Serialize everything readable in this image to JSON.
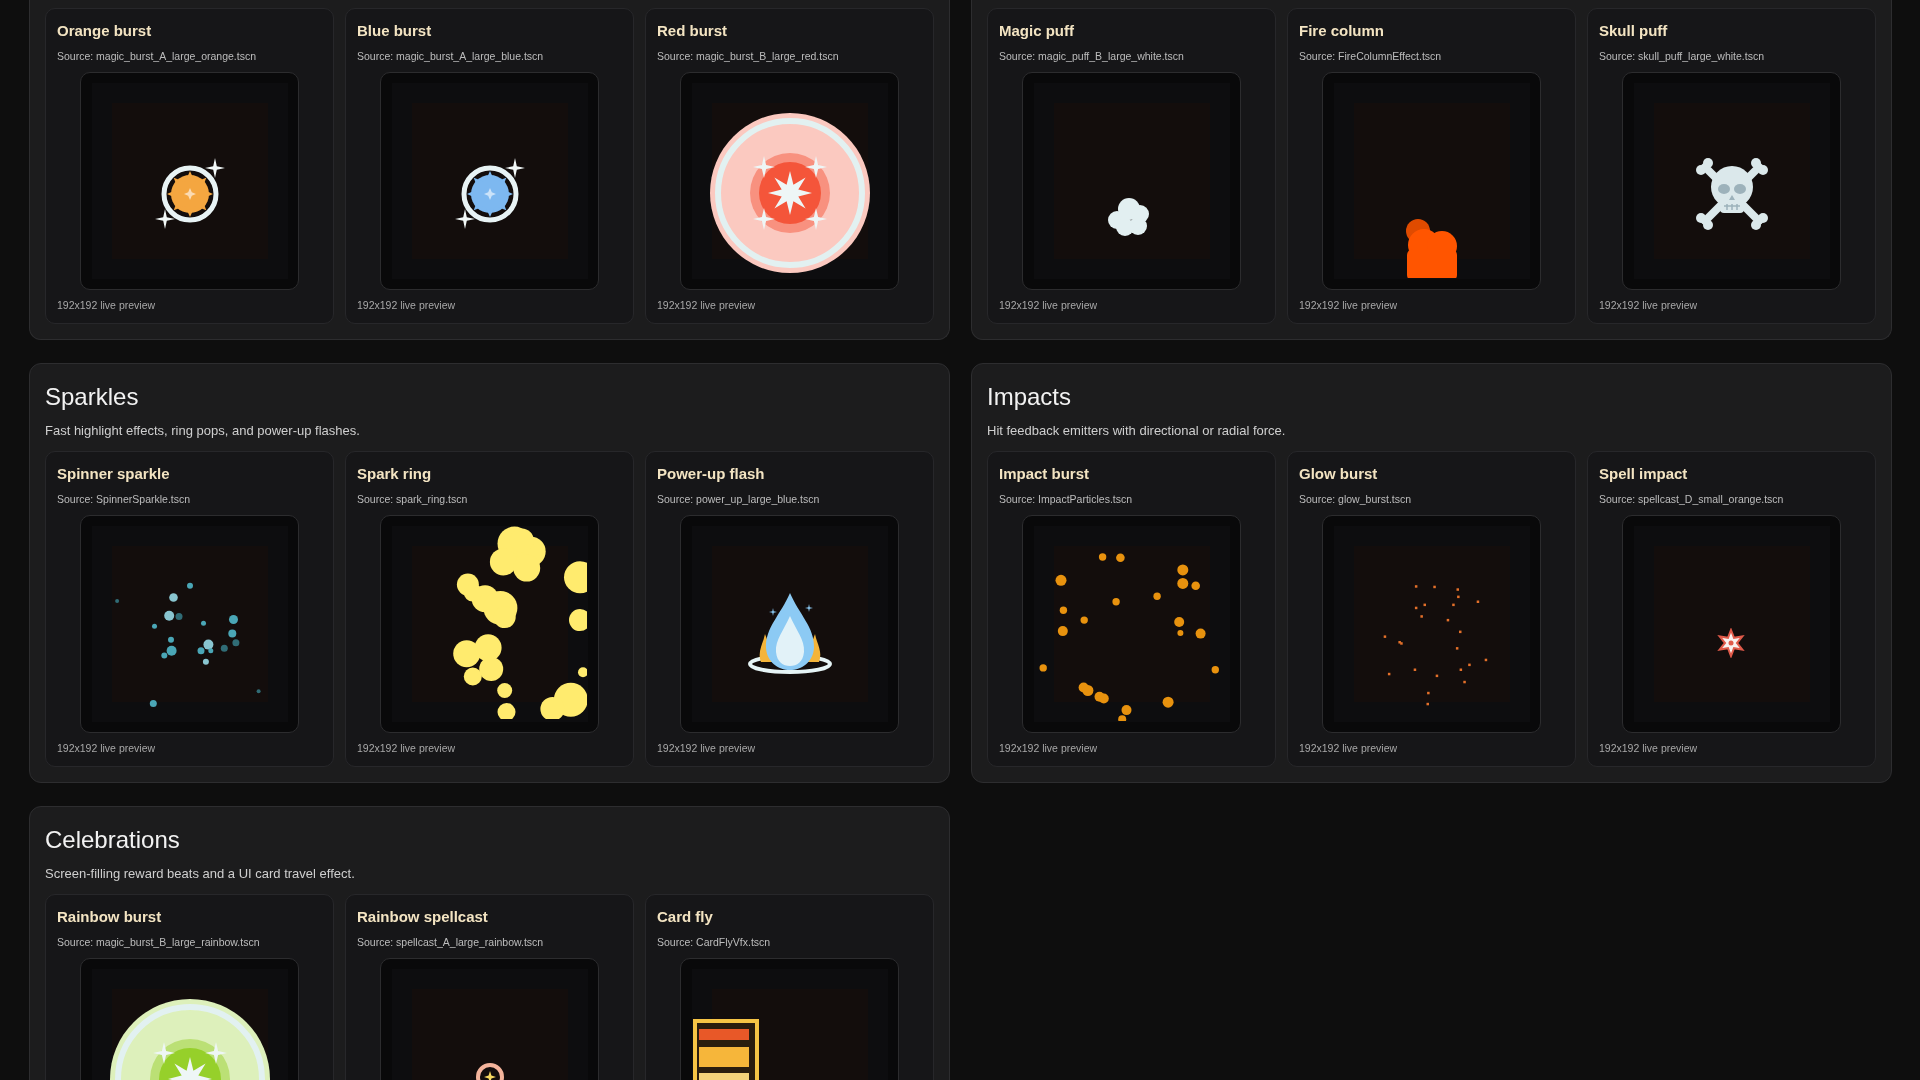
{
  "sections": [
    {
      "cards": [
        {
          "title": "Orange burst",
          "source": "Source: magic_burst_A_large_orange.tscn",
          "preview": {
            "kind": "burst",
            "color": "#f4a640"
          },
          "caption": "192x192 live preview"
        },
        {
          "title": "Blue burst",
          "source": "Source: magic_burst_A_large_blue.tscn",
          "preview": {
            "kind": "burst",
            "color": "#7db8f0"
          },
          "caption": "192x192 live preview"
        },
        {
          "title": "Red burst",
          "source": "Source: magic_burst_B_large_red.tscn",
          "preview": {
            "kind": "disc",
            "color": "#f4553a"
          },
          "caption": "192x192 live preview"
        }
      ]
    },
    {
      "cards": [
        {
          "title": "Magic puff",
          "source": "Source: magic_puff_B_large_white.tscn",
          "preview": {
            "kind": "puff",
            "color": "#e2eff1"
          },
          "caption": "192x192 live preview"
        },
        {
          "title": "Fire column",
          "source": "Source: FireColumnEffect.tscn",
          "preview": {
            "kind": "column",
            "color": "#ff5500"
          },
          "caption": "192x192 live preview"
        },
        {
          "title": "Skull puff",
          "source": "Source: skull_puff_large_white.tscn",
          "preview": {
            "kind": "skull",
            "color": "#dbe8eb"
          },
          "caption": "192x192 live preview"
        }
      ]
    },
    {
      "title": "Sparkles",
      "description": "Fast highlight effects, ring pops, and power-up flashes.",
      "cards": [
        {
          "title": "Spinner sparkle",
          "source": "Source: SpinnerSparkle.tscn",
          "preview": {
            "kind": "spinner",
            "color": "#4aa6b6"
          },
          "caption": "192x192 live preview"
        },
        {
          "title": "Spark ring",
          "source": "Source: spark_ring.tscn",
          "preview": {
            "kind": "cluster",
            "color": "#ffeb6e"
          },
          "caption": "192x192 live preview"
        },
        {
          "title": "Power-up flash",
          "source": "Source: power_up_large_blue.tscn",
          "preview": {
            "kind": "flame",
            "color": "#8ccaf4"
          },
          "caption": "192x192 live preview"
        }
      ]
    },
    {
      "title": "Impacts",
      "description": "Hit feedback emitters with directional or radial force.",
      "cards": [
        {
          "title": "Impact burst",
          "source": "Source: ImpactParticles.tscn",
          "preview": {
            "kind": "impact",
            "color": "#e8920e"
          },
          "caption": "192x192 live preview"
        },
        {
          "title": "Glow burst",
          "source": "Source: glow_burst.tscn",
          "preview": {
            "kind": "embers",
            "color": "#e4702a"
          },
          "caption": "192x192 live preview"
        },
        {
          "title": "Spell impact",
          "source": "Source: spellcast_D_small_orange.tscn",
          "preview": {
            "kind": "star",
            "color": "#e05a4a"
          },
          "caption": "192x192 live preview"
        }
      ]
    },
    {
      "title": "Celebrations",
      "description": "Screen-filling reward beats and a UI card travel effect.",
      "cards": [
        {
          "title": "Rainbow burst",
          "source": "Source: magic_burst_B_large_rainbow.tscn",
          "preview": {
            "kind": "disc",
            "color": "#96d02a"
          }
        },
        {
          "title": "Rainbow spellcast",
          "source": "Source: spellcast_A_large_rainbow.tscn",
          "preview": {
            "kind": "halo",
            "color": "#f4b49c"
          }
        },
        {
          "title": "Card fly",
          "source": "Source: CardFlyVfx.tscn",
          "preview": {
            "kind": "card",
            "color": "#f6c445"
          }
        }
      ]
    }
  ]
}
